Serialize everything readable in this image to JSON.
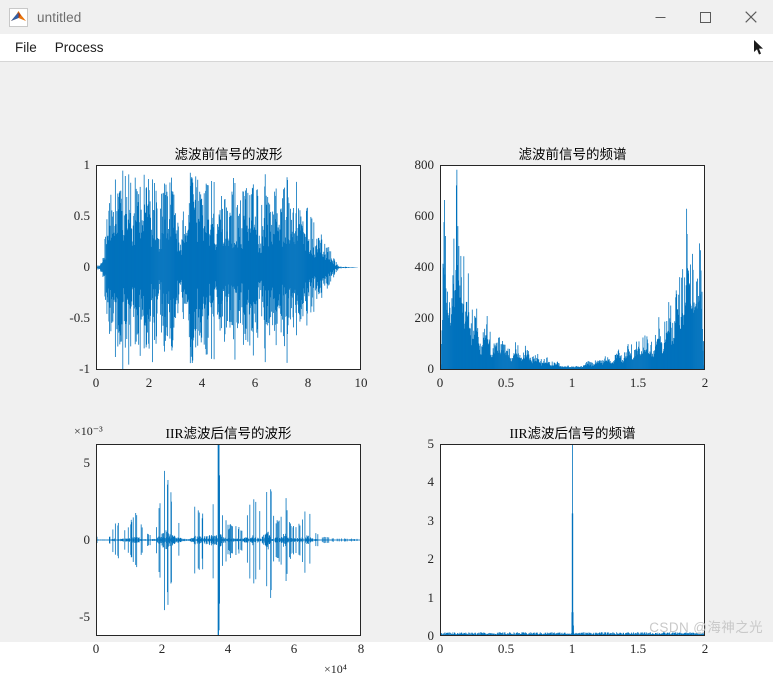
{
  "window": {
    "title": "untitled",
    "app_icon": "matlab-figure-icon",
    "controls": {
      "minimize": "minimize-icon",
      "maximize": "maximize-icon",
      "close": "close-icon"
    }
  },
  "menubar": {
    "items": [
      {
        "label": "File",
        "name": "menu-file"
      },
      {
        "label": "Process",
        "name": "menu-process"
      }
    ],
    "cursor": "mouse-pointer-icon"
  },
  "watermark": "CSDN @海神之光",
  "colors": {
    "line": "#0072BD",
    "axis": "#262626",
    "figure_bg": "#F0F0F0",
    "plot_bg": "#FFFFFF"
  },
  "chart_data": [
    {
      "id": "plot-waveform-before",
      "type": "line",
      "title": "滤波前信号的波形",
      "xlabel": "",
      "ylabel": "",
      "xlim": [
        0,
        10
      ],
      "ylim": [
        -1,
        1
      ],
      "xticks": [
        "0",
        "2",
        "4",
        "6",
        "8",
        "10"
      ],
      "yticks": [
        "1",
        "0.5",
        "0",
        "-0.5",
        "-1"
      ],
      "grid": false,
      "legend": "none",
      "description": "Dense audio waveform, amplitude saturating near +/-1 across 0 to about 9, quieter tail from 8.5 to 9.",
      "envelope": [
        {
          "x": 0.0,
          "amp": 0.02
        },
        {
          "x": 0.2,
          "amp": 0.05
        },
        {
          "x": 0.4,
          "amp": 0.55
        },
        {
          "x": 0.6,
          "amp": 0.98
        },
        {
          "x": 0.8,
          "amp": 0.8
        },
        {
          "x": 1.0,
          "amp": 1.0
        },
        {
          "x": 1.2,
          "amp": 0.92
        },
        {
          "x": 1.4,
          "amp": 1.0
        },
        {
          "x": 1.6,
          "amp": 0.85
        },
        {
          "x": 1.8,
          "amp": 0.96
        },
        {
          "x": 2.0,
          "amp": 0.88
        },
        {
          "x": 2.2,
          "amp": 1.0
        },
        {
          "x": 2.4,
          "amp": 0.7
        },
        {
          "x": 2.6,
          "amp": 0.95
        },
        {
          "x": 2.8,
          "amp": 1.0
        },
        {
          "x": 3.0,
          "amp": 0.62
        },
        {
          "x": 3.2,
          "amp": 0.35
        },
        {
          "x": 3.4,
          "amp": 0.9
        },
        {
          "x": 3.6,
          "amp": 1.0
        },
        {
          "x": 3.8,
          "amp": 0.98
        },
        {
          "x": 4.0,
          "amp": 0.74
        },
        {
          "x": 4.2,
          "amp": 0.96
        },
        {
          "x": 4.4,
          "amp": 1.0
        },
        {
          "x": 4.6,
          "amp": 0.45
        },
        {
          "x": 4.8,
          "amp": 0.86
        },
        {
          "x": 5.0,
          "amp": 0.66
        },
        {
          "x": 5.2,
          "amp": 0.92
        },
        {
          "x": 5.4,
          "amp": 0.58
        },
        {
          "x": 5.6,
          "amp": 0.98
        },
        {
          "x": 5.8,
          "amp": 0.7
        },
        {
          "x": 6.0,
          "amp": 0.95
        },
        {
          "x": 6.2,
          "amp": 0.6
        },
        {
          "x": 6.4,
          "amp": 1.0
        },
        {
          "x": 6.6,
          "amp": 0.55
        },
        {
          "x": 6.8,
          "amp": 0.88
        },
        {
          "x": 7.0,
          "amp": 0.64
        },
        {
          "x": 7.2,
          "amp": 0.97
        },
        {
          "x": 7.4,
          "amp": 0.52
        },
        {
          "x": 7.6,
          "amp": 0.9
        },
        {
          "x": 7.8,
          "amp": 0.45
        },
        {
          "x": 8.0,
          "amp": 0.62
        },
        {
          "x": 8.2,
          "amp": 0.5
        },
        {
          "x": 8.4,
          "amp": 0.4
        },
        {
          "x": 8.6,
          "amp": 0.3
        },
        {
          "x": 8.8,
          "amp": 0.22
        },
        {
          "x": 9.0,
          "amp": 0.1
        },
        {
          "x": 9.2,
          "amp": 0.01
        },
        {
          "x": 10.0,
          "amp": 0.0
        }
      ]
    },
    {
      "id": "plot-spectrum-before",
      "type": "line",
      "title": "滤波前信号的频谱",
      "xlabel": "",
      "ylabel": "",
      "xlim": [
        0,
        2
      ],
      "ylim": [
        0,
        800
      ],
      "xticks": [
        "0",
        "0.5",
        "1",
        "1.5",
        "2"
      ],
      "yticks": [
        "800",
        "600",
        "400",
        "200",
        "0"
      ],
      "grid": false,
      "legend": "none",
      "description": "Symmetric U-shaped magnitude spectrum; tall peaks near 750 at x≈0.12 and x≈1.88, decaying to near 0 at x=1.",
      "envelope": [
        {
          "x": 0.0,
          "amp": 40
        },
        {
          "x": 0.02,
          "amp": 690
        },
        {
          "x": 0.05,
          "amp": 430
        },
        {
          "x": 0.08,
          "amp": 600
        },
        {
          "x": 0.1,
          "amp": 500
        },
        {
          "x": 0.12,
          "amp": 755
        },
        {
          "x": 0.14,
          "amp": 560
        },
        {
          "x": 0.16,
          "amp": 620
        },
        {
          "x": 0.18,
          "amp": 330
        },
        {
          "x": 0.21,
          "amp": 420
        },
        {
          "x": 0.24,
          "amp": 250
        },
        {
          "x": 0.27,
          "amp": 300
        },
        {
          "x": 0.3,
          "amp": 180
        },
        {
          "x": 0.34,
          "amp": 260
        },
        {
          "x": 0.38,
          "amp": 150
        },
        {
          "x": 0.42,
          "amp": 120
        },
        {
          "x": 0.46,
          "amp": 160
        },
        {
          "x": 0.5,
          "amp": 100
        },
        {
          "x": 0.55,
          "amp": 110
        },
        {
          "x": 0.6,
          "amp": 80
        },
        {
          "x": 0.65,
          "amp": 90
        },
        {
          "x": 0.7,
          "amp": 60
        },
        {
          "x": 0.75,
          "amp": 55
        },
        {
          "x": 0.8,
          "amp": 45
        },
        {
          "x": 0.85,
          "amp": 35
        },
        {
          "x": 0.9,
          "amp": 25
        },
        {
          "x": 0.95,
          "amp": 15
        },
        {
          "x": 1.0,
          "amp": 10
        },
        {
          "x": 1.05,
          "amp": 15
        },
        {
          "x": 1.1,
          "amp": 25
        },
        {
          "x": 1.15,
          "amp": 35
        },
        {
          "x": 1.2,
          "amp": 45
        },
        {
          "x": 1.25,
          "amp": 55
        },
        {
          "x": 1.3,
          "amp": 60
        },
        {
          "x": 1.35,
          "amp": 90
        },
        {
          "x": 1.4,
          "amp": 80
        },
        {
          "x": 1.45,
          "amp": 110
        },
        {
          "x": 1.5,
          "amp": 100
        },
        {
          "x": 1.54,
          "amp": 160
        },
        {
          "x": 1.58,
          "amp": 120
        },
        {
          "x": 1.62,
          "amp": 150
        },
        {
          "x": 1.66,
          "amp": 260
        },
        {
          "x": 1.7,
          "amp": 180
        },
        {
          "x": 1.73,
          "amp": 300
        },
        {
          "x": 1.76,
          "amp": 250
        },
        {
          "x": 1.79,
          "amp": 420
        },
        {
          "x": 1.82,
          "amp": 330
        },
        {
          "x": 1.84,
          "amp": 620
        },
        {
          "x": 1.86,
          "amp": 560
        },
        {
          "x": 1.88,
          "amp": 755
        },
        {
          "x": 1.9,
          "amp": 500
        },
        {
          "x": 1.92,
          "amp": 600
        },
        {
          "x": 1.95,
          "amp": 430
        },
        {
          "x": 1.98,
          "amp": 690
        },
        {
          "x": 2.0,
          "amp": 40
        }
      ]
    },
    {
      "id": "plot-waveform-after",
      "type": "line",
      "title": "IIR滤波后信号的波形",
      "xlabel": "",
      "ylabel": "",
      "x_exponent": "×10⁴",
      "y_exponent": "×10⁻³",
      "xlim": [
        0,
        80000
      ],
      "ylim": [
        -7.5,
        7.5
      ],
      "xticks": [
        "0",
        "2",
        "4",
        "6",
        "8"
      ],
      "yticks": [
        "5",
        "0",
        "-5"
      ],
      "grid": false,
      "legend": "none",
      "description": "Sparse impulse-train style waveform, amplitude mostly within +/-4e-3, one full-height vertical spike at x≈3.7e4.",
      "envelope": [
        {
          "x": 4000,
          "amp": 0.3
        },
        {
          "x": 6000,
          "amp": 1.6
        },
        {
          "x": 8000,
          "amp": 1.0
        },
        {
          "x": 10000,
          "amp": 1.4
        },
        {
          "x": 12000,
          "amp": 2.4
        },
        {
          "x": 14000,
          "amp": 0.8
        },
        {
          "x": 16000,
          "amp": 0.5
        },
        {
          "x": 18000,
          "amp": 0.9
        },
        {
          "x": 20000,
          "amp": 5.6
        },
        {
          "x": 21000,
          "amp": 6.8
        },
        {
          "x": 22000,
          "amp": 4.2
        },
        {
          "x": 24000,
          "amp": 2.6
        },
        {
          "x": 26000,
          "amp": 1.0
        },
        {
          "x": 28000,
          "amp": 0.6
        },
        {
          "x": 30000,
          "amp": 3.0
        },
        {
          "x": 32000,
          "amp": 2.0
        },
        {
          "x": 34000,
          "amp": 3.6
        },
        {
          "x": 36000,
          "amp": 3.2
        },
        {
          "x": 37000,
          "amp": 7.5
        },
        {
          "x": 38000,
          "amp": 2.4
        },
        {
          "x": 40000,
          "amp": 1.2
        },
        {
          "x": 42000,
          "amp": 1.5
        },
        {
          "x": 44000,
          "amp": 0.7
        },
        {
          "x": 46000,
          "amp": 2.8
        },
        {
          "x": 48000,
          "amp": 3.4
        },
        {
          "x": 50000,
          "amp": 2.2
        },
        {
          "x": 52000,
          "amp": 6.0
        },
        {
          "x": 54000,
          "amp": 1.6
        },
        {
          "x": 56000,
          "amp": 2.4
        },
        {
          "x": 57000,
          "amp": 5.8
        },
        {
          "x": 58000,
          "amp": 1.8
        },
        {
          "x": 60000,
          "amp": 1.2
        },
        {
          "x": 62000,
          "amp": 1.5
        },
        {
          "x": 64000,
          "amp": 3.2
        },
        {
          "x": 66000,
          "amp": 0.8
        },
        {
          "x": 68000,
          "amp": 0.3
        },
        {
          "x": 72000,
          "amp": 0.15
        },
        {
          "x": 78000,
          "amp": 0.1
        }
      ]
    },
    {
      "id": "plot-spectrum-after",
      "type": "line",
      "title": "IIR滤波后信号的频谱",
      "xlabel": "",
      "ylabel": "",
      "xlim": [
        0,
        2
      ],
      "ylim": [
        0,
        5
      ],
      "xticks": [
        "0",
        "0.5",
        "1",
        "1.5",
        "2"
      ],
      "yticks": [
        "5",
        "4",
        "3",
        "2",
        "1",
        "0"
      ],
      "grid": false,
      "legend": "none",
      "description": "Near-zero noise floor with a single narrow spike at x=1 reaching the top of the axis (5), with shoulders at 3.2 and 0.6.",
      "peaks": [
        {
          "x": 1.0,
          "value": 5.0
        },
        {
          "x": 0.998,
          "value": 3.2
        },
        {
          "x": 1.002,
          "value": 0.6
        }
      ],
      "noise_floor": 0.04
    }
  ]
}
